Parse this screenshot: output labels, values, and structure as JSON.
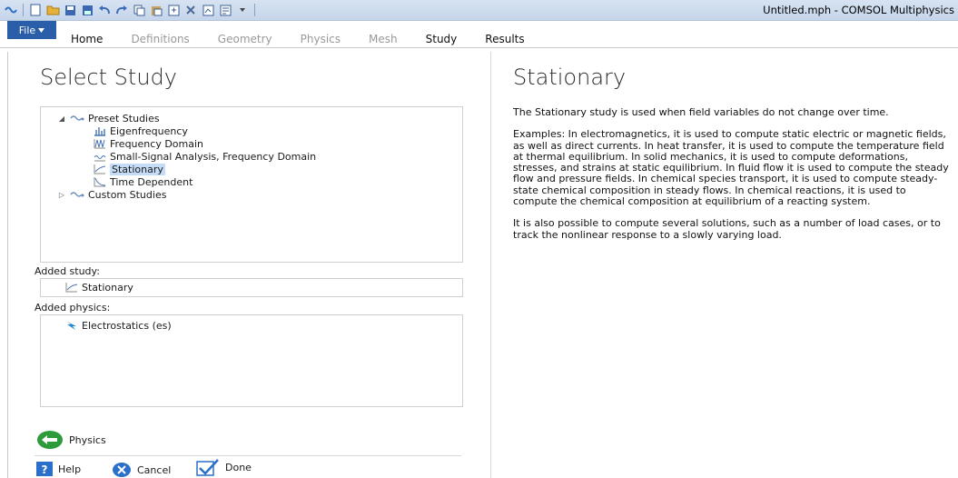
{
  "window": {
    "title": "Untitled.mph - COMSOL Multiphysics"
  },
  "ribbon": {
    "file_label": "File",
    "tabs": [
      "Home",
      "Definitions",
      "Geometry",
      "Physics",
      "Mesh",
      "Study",
      "Results"
    ]
  },
  "left": {
    "title": "Select Study",
    "tree": {
      "preset_label": "Preset Studies",
      "items": [
        "Eigenfrequency",
        "Frequency Domain",
        "Small-Signal Analysis, Frequency Domain",
        "Stationary",
        "Time Dependent"
      ],
      "selected": "Stationary",
      "custom_label": "Custom Studies"
    },
    "added_study_label": "Added study:",
    "added_study_value": "Stationary",
    "added_physics_label": "Added physics:",
    "added_physics_value": "Electrostatics (es)",
    "back_button_label": "Physics",
    "help_label": "Help",
    "cancel_label": "Cancel",
    "done_label": "Done"
  },
  "right": {
    "title": "Stationary",
    "para1": "The Stationary study is used when field variables do not change over time.",
    "para2": "Examples: In electromagnetics, it is used to compute static electric or magnetic fields, as well as direct currents. In heat transfer, it is used to compute the temperature field at thermal equilibrium. In solid mechanics, it is used to compute deformations, stresses, and strains at static equilibrium. In fluid flow it is used to compute the steady flow and pressure fields. In chemical species transport, it is used to compute steady-state chemical composition in steady flows. In chemical reactions, it is used to compute the chemical composition at equilibrium of a reacting system.",
    "para3": "It is also possible to compute several solutions, such as a number of load cases, or to track the nonlinear response to a slowly varying load."
  },
  "colors": {
    "accent": "#2a5ea8",
    "selection": "#c4dcf7",
    "back_button": "#2e9b3a",
    "help": "#2a6fc9",
    "cancel": "#2a6fc9"
  }
}
